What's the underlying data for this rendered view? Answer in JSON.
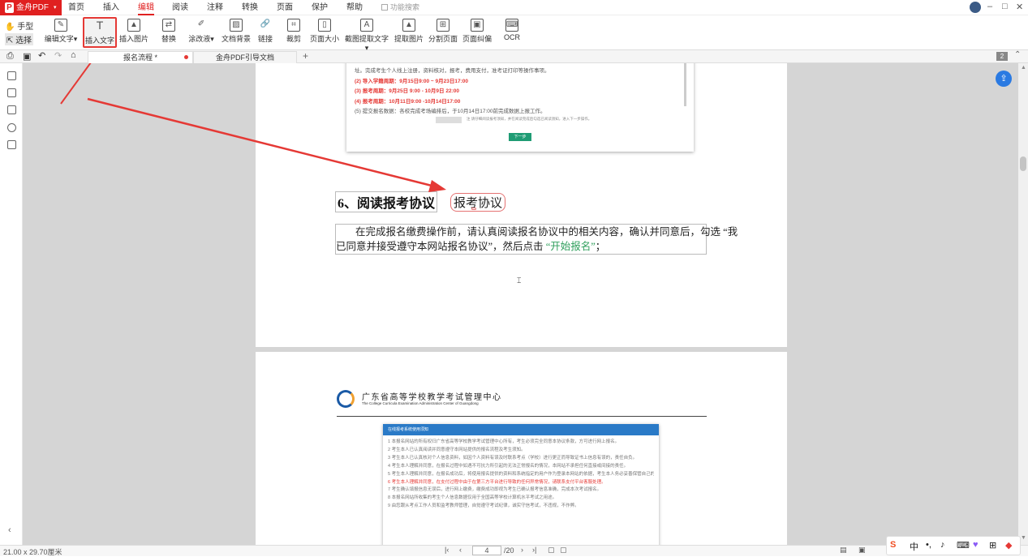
{
  "app": {
    "name": "金舟PDF"
  },
  "menu": {
    "items": [
      "首页",
      "插入",
      "编辑",
      "阅读",
      "注释",
      "转换",
      "页面",
      "保护",
      "帮助"
    ],
    "search_placeholder": "功能搜索"
  },
  "toolbar": {
    "hand": "手型",
    "select": "选择",
    "tools": [
      "编辑文字",
      "插入文字",
      "插入图片",
      "替换",
      "涂改液",
      "文档背景",
      "链接",
      "裁剪",
      "页面大小",
      "截图提取文字",
      "提取图片",
      "分割页面",
      "页面纠偏",
      "OCR"
    ]
  },
  "tabs": [
    {
      "label": "报名流程 *"
    },
    {
      "label": "金舟PDF引导文档"
    }
  ],
  "page_count_badge": "2",
  "page1": {
    "screenshot_lines": [
      "址。完成考生个人线上注册，资料核对，报考，费用支付，准考证打印等操作事项。",
      "(2) 导入学籍周期：9月15日9:00 ~ 9月23日17:00",
      "(3) 报考周期：9月25日 9:00 - 10月9日 22:00",
      "(4) 报考周期：10月11日9:00 -10月14日17:00",
      "(5) 提交报名数据：各校完成考场编排后，于10月14日17:00前完成数据上报工作。"
    ],
    "screenshot_note": "注 请仔细阅读报考须知，并在阅读完成后勾选已阅读须知，进入下一步操作。",
    "screenshot_button": "下一步",
    "heading": "6、阅读报考协议",
    "inserted_text": "报考协议",
    "para_line1": "在完成报名缴费操作前，请认真阅读报名协议中的相关内容，确认并同意后，勾选 “我",
    "para_line2_a": "已同意并接受遵守本网站报名协议”，然后点击",
    "para_link": "“开始报名”",
    "para_line2_b": "；"
  },
  "page2": {
    "org_cn": "广东省高等学校教学考试管理中心",
    "org_en": "The College Curricula Examination Administration Center of Guangdong",
    "panel_title": "在线报考系统使用须知",
    "panel_items": [
      "1 本报名网站的所有权归广东省高等学校教学考试管理中心所有，考生必须完全同意本协议条款，方可进行网上报名。",
      "2 考生本人已认真阅读并同意遵守本网站提供的报名流程及考生须知。",
      "3 考生本人已认真核对个人信息资料，如因个人资料有误及时联系考点（学校）进行更正而导致证书上信息有误的，责任自负。",
      "4 考生本人理解并同意，在报名过程中如遇不可抗力所引起的无法正常报名的情况，本网站不承担任何直接或间接的责任。",
      "5 考生本人理解并同意，在报名成功后，将使用报名提供的资料和系统指定的用户作为登录本网站的依据，考生本人务必妥善保管自己的资料。",
      "6 考生本人理解并同意，在支付过程中由于在第三方平台进行导致的任何异常情况，请联系支付平台客服处理。",
      "7 考生确认填报信息无误后，进行网上缴费，缴费成功即视为考生已确认报考信息准确，完成本次考试报名。",
      "8 本报名网站所收集的考生个人信息数据仅用于全国高等学校计算机水平考试之用途。",
      "9 由您跟从考点工作人员和监考教师管理，自觉遵守考试纪律，诚实守信考试，不违规，不作弊。"
    ]
  },
  "status": {
    "page_size": "21.00 x 29.70厘米",
    "current_page": "4",
    "total_pages": "/20"
  },
  "ime": {
    "items": [
      "中",
      "•,",
      "🎤",
      "⌨"
    ]
  }
}
